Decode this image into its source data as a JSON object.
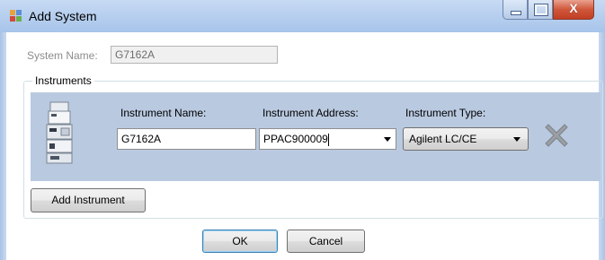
{
  "window": {
    "title": "Add System",
    "controls": {
      "minimize": "minimize",
      "maximize": "maximize",
      "close": "X"
    }
  },
  "system_name": {
    "label": "System Name:",
    "value": "G7162A"
  },
  "instruments": {
    "group_label": "Instruments",
    "rows": [
      {
        "name_label": "Instrument Name:",
        "name_value": "G7162A",
        "address_label": "Instrument Address:",
        "address_value": "PPAC900009",
        "type_label": "Instrument Type:",
        "type_value": "Agilent LC/CE"
      }
    ],
    "add_button": "Add Instrument"
  },
  "buttons": {
    "ok": "OK",
    "cancel": "Cancel"
  },
  "icons": {
    "app": "app-icon",
    "instrument": "lc-instrument-icon",
    "remove": "remove-x-icon",
    "dropdown": "chevron-down-icon"
  },
  "colors": {
    "panel": "#b9c9e0",
    "titlebar": "#b8d0ef",
    "close_button": "#c94a30",
    "default_button_border": "#3c7fb1"
  }
}
